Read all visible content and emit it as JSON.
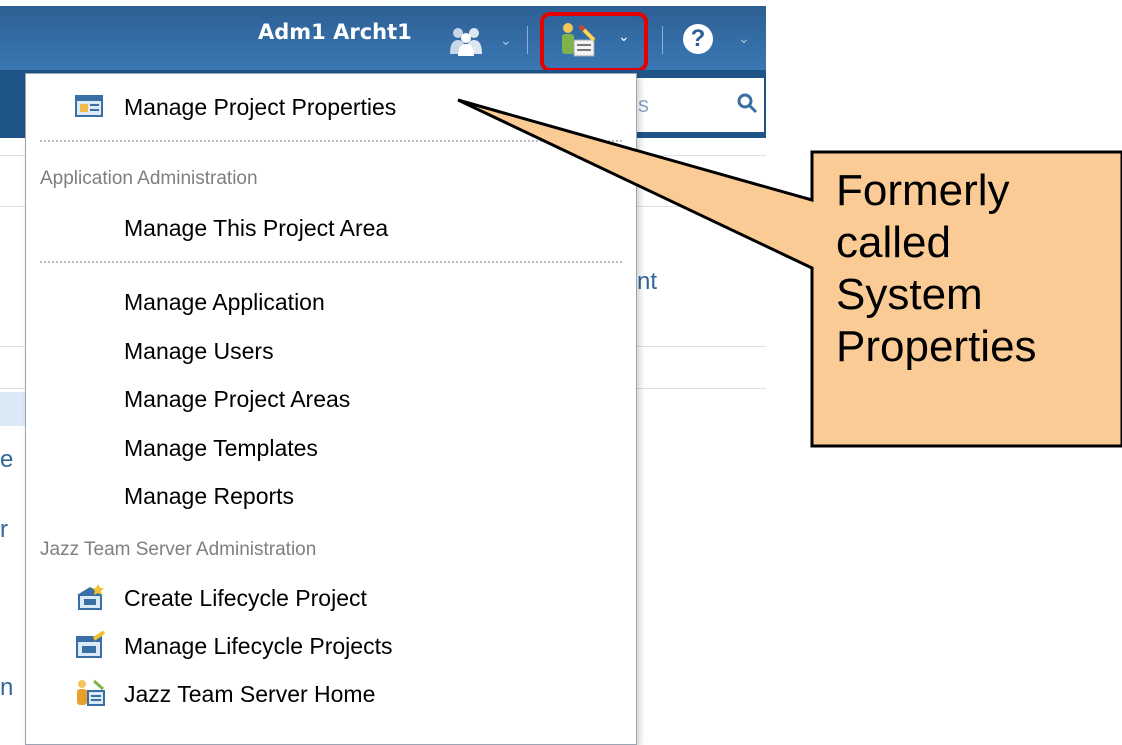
{
  "header": {
    "user_name": "Adm1 Archt1",
    "help_label": "?"
  },
  "page": {
    "search_hint": "s",
    "right_link_fragment": "nt",
    "left_fragments": [
      "e",
      "r",
      "n"
    ]
  },
  "menu": {
    "top_items": [
      {
        "label": "Manage Project Properties",
        "icon": "project-properties-icon"
      }
    ],
    "sections": [
      {
        "title": "Application Administration",
        "items": [
          {
            "label": "Manage This Project Area"
          }
        ],
        "items_after_separator": [
          {
            "label": "Manage Application"
          },
          {
            "label": "Manage Users"
          },
          {
            "label": "Manage Project Areas"
          },
          {
            "label": "Manage Templates"
          },
          {
            "label": "Manage Reports"
          }
        ]
      },
      {
        "title": "Jazz Team Server Administration",
        "items": [
          {
            "label": "Create Lifecycle Project",
            "icon": "create-lifecycle-project-icon"
          },
          {
            "label": "Manage Lifecycle Projects",
            "icon": "manage-lifecycle-projects-icon"
          },
          {
            "label": "Jazz Team Server Home",
            "icon": "jazz-team-server-icon"
          }
        ]
      }
    ]
  },
  "callout": {
    "lines": [
      "Formerly",
      "called",
      "System",
      "Properties"
    ],
    "fill_color": "#fbcb95",
    "highlight_color": "#e60000"
  }
}
